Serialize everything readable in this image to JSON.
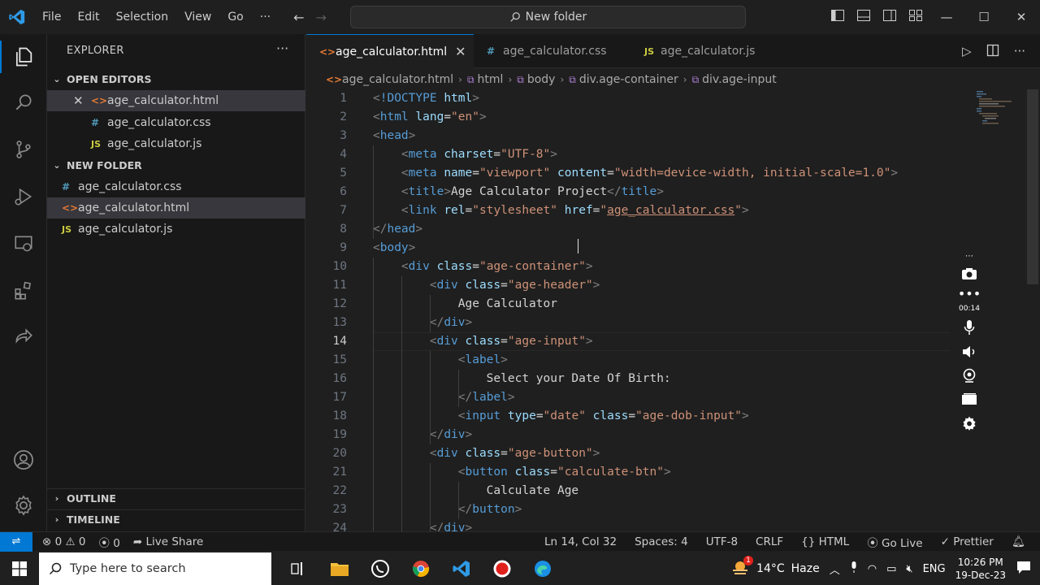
{
  "menu": [
    "File",
    "Edit",
    "Selection",
    "View",
    "Go",
    "···"
  ],
  "search": {
    "label": "New folder"
  },
  "explorer": {
    "title": "EXPLORER",
    "more": "···",
    "open_editors": {
      "label": "OPEN EDITORS",
      "items": [
        {
          "name": "age_calculator.html",
          "type": "html"
        },
        {
          "name": "age_calculator.css",
          "type": "css"
        },
        {
          "name": "age_calculator.js",
          "type": "js"
        }
      ]
    },
    "folder": {
      "label": "NEW FOLDER",
      "items": [
        {
          "name": "age_calculator.css",
          "type": "css"
        },
        {
          "name": "age_calculator.html",
          "type": "html"
        },
        {
          "name": "age_calculator.js",
          "type": "js"
        }
      ]
    },
    "outline": "OUTLINE",
    "timeline": "TIMELINE"
  },
  "tabs": [
    {
      "label": "age_calculator.html",
      "type": "html",
      "active": true
    },
    {
      "label": "age_calculator.css",
      "type": "css",
      "active": false
    },
    {
      "label": "age_calculator.js",
      "type": "js",
      "active": false
    }
  ],
  "breadcrumb": [
    "age_calculator.html",
    "html",
    "body",
    "div.age-container",
    "div.age-input"
  ],
  "code": {
    "current_line": 14,
    "lines": [
      [
        [
          "pun",
          "<"
        ],
        [
          "tag",
          "!DOCTYPE "
        ],
        [
          "attr",
          "html"
        ],
        [
          "pun",
          ">"
        ]
      ],
      [
        [
          "pun",
          "<"
        ],
        [
          "tag",
          "html "
        ],
        [
          "attr",
          "lang"
        ],
        [
          "plain",
          "="
        ],
        [
          "str",
          "\"en\""
        ],
        [
          "pun",
          ">"
        ]
      ],
      [
        [
          "pun",
          "<"
        ],
        [
          "tag",
          "head"
        ],
        [
          "pun",
          ">"
        ]
      ],
      [
        [
          "plain",
          "    "
        ],
        [
          "pun",
          "<"
        ],
        [
          "tag",
          "meta "
        ],
        [
          "attr",
          "charset"
        ],
        [
          "plain",
          "="
        ],
        [
          "str",
          "\"UTF-8\""
        ],
        [
          "pun",
          ">"
        ]
      ],
      [
        [
          "plain",
          "    "
        ],
        [
          "pun",
          "<"
        ],
        [
          "tag",
          "meta "
        ],
        [
          "attr",
          "name"
        ],
        [
          "plain",
          "="
        ],
        [
          "str",
          "\"viewport\" "
        ],
        [
          "attr",
          "content"
        ],
        [
          "plain",
          "="
        ],
        [
          "str",
          "\"width=device-width, initial-scale=1.0\""
        ],
        [
          "pun",
          ">"
        ]
      ],
      [
        [
          "plain",
          "    "
        ],
        [
          "pun",
          "<"
        ],
        [
          "tag",
          "title"
        ],
        [
          "pun",
          ">"
        ],
        [
          "plain",
          "Age Calculator Project"
        ],
        [
          "pun",
          "</"
        ],
        [
          "tag",
          "title"
        ],
        [
          "pun",
          ">"
        ]
      ],
      [
        [
          "plain",
          "    "
        ],
        [
          "pun",
          "<"
        ],
        [
          "tag",
          "link "
        ],
        [
          "attr",
          "rel"
        ],
        [
          "plain",
          "="
        ],
        [
          "str",
          "\"stylesheet\" "
        ],
        [
          "attr",
          "href"
        ],
        [
          "plain",
          "="
        ],
        [
          "str",
          "\""
        ],
        [
          "strlink",
          "age_calculator.css"
        ],
        [
          "str",
          "\""
        ],
        [
          "pun",
          ">"
        ]
      ],
      [
        [
          "pun",
          "</"
        ],
        [
          "tag",
          "head"
        ],
        [
          "pun",
          ">"
        ]
      ],
      [
        [
          "pun",
          "<"
        ],
        [
          "tag",
          "body"
        ],
        [
          "pun",
          ">"
        ]
      ],
      [
        [
          "plain",
          "    "
        ],
        [
          "pun",
          "<"
        ],
        [
          "tag",
          "div "
        ],
        [
          "attr",
          "class"
        ],
        [
          "plain",
          "="
        ],
        [
          "str",
          "\"age-container\""
        ],
        [
          "pun",
          ">"
        ]
      ],
      [
        [
          "plain",
          "        "
        ],
        [
          "pun",
          "<"
        ],
        [
          "tag",
          "div "
        ],
        [
          "attr",
          "class"
        ],
        [
          "plain",
          "="
        ],
        [
          "str",
          "\"age-header\""
        ],
        [
          "pun",
          ">"
        ]
      ],
      [
        [
          "plain",
          "            Age Calculator"
        ]
      ],
      [
        [
          "plain",
          "        "
        ],
        [
          "pun",
          "</"
        ],
        [
          "tag",
          "div"
        ],
        [
          "pun",
          ">"
        ]
      ],
      [
        [
          "plain",
          "        "
        ],
        [
          "pun",
          "<"
        ],
        [
          "tag",
          "div "
        ],
        [
          "attr",
          "class"
        ],
        [
          "plain",
          "="
        ],
        [
          "str",
          "\"age-input\""
        ],
        [
          "pun",
          ">"
        ]
      ],
      [
        [
          "plain",
          "            "
        ],
        [
          "pun",
          "<"
        ],
        [
          "tag",
          "label"
        ],
        [
          "pun",
          ">"
        ]
      ],
      [
        [
          "plain",
          "                Select your Date Of Birth:"
        ]
      ],
      [
        [
          "plain",
          "            "
        ],
        [
          "pun",
          "</"
        ],
        [
          "tag",
          "label"
        ],
        [
          "pun",
          ">"
        ]
      ],
      [
        [
          "plain",
          "            "
        ],
        [
          "pun",
          "<"
        ],
        [
          "tag",
          "input "
        ],
        [
          "attr",
          "type"
        ],
        [
          "plain",
          "="
        ],
        [
          "str",
          "\"date\" "
        ],
        [
          "attr",
          "class"
        ],
        [
          "plain",
          "="
        ],
        [
          "str",
          "\"age-dob-input\""
        ],
        [
          "pun",
          ">"
        ]
      ],
      [
        [
          "plain",
          "        "
        ],
        [
          "pun",
          "</"
        ],
        [
          "tag",
          "div"
        ],
        [
          "pun",
          ">"
        ]
      ],
      [
        [
          "plain",
          "        "
        ],
        [
          "pun",
          "<"
        ],
        [
          "tag",
          "div "
        ],
        [
          "attr",
          "class"
        ],
        [
          "plain",
          "="
        ],
        [
          "str",
          "\"age-button\""
        ],
        [
          "pun",
          ">"
        ]
      ],
      [
        [
          "plain",
          "            "
        ],
        [
          "pun",
          "<"
        ],
        [
          "tag",
          "button "
        ],
        [
          "attr",
          "class"
        ],
        [
          "plain",
          "="
        ],
        [
          "str",
          "\"calculate-btn\""
        ],
        [
          "pun",
          ">"
        ]
      ],
      [
        [
          "plain",
          "                Calculate Age"
        ]
      ],
      [
        [
          "plain",
          "            "
        ],
        [
          "pun",
          "</"
        ],
        [
          "tag",
          "button"
        ],
        [
          "pun",
          ">"
        ]
      ],
      [
        [
          "plain",
          "        "
        ],
        [
          "pun",
          "</"
        ],
        [
          "tag",
          "div"
        ],
        [
          "pun",
          ">"
        ]
      ]
    ]
  },
  "recorder": {
    "time": "00:14"
  },
  "status": {
    "errors": "0",
    "warnings": "0",
    "ports": "0",
    "live_share": "Live Share",
    "position": "Ln 14, Col 32",
    "spaces": "Spaces: 4",
    "encoding": "UTF-8",
    "eol": "CRLF",
    "language": "HTML",
    "go_live": "Go Live",
    "prettier": "Prettier"
  },
  "taskbar": {
    "search_placeholder": "Type here to search",
    "weather_temp": "14°C",
    "weather_desc": "Haze",
    "weather_badge": "1",
    "lang": "ENG",
    "time": "10:26 PM",
    "date": "19-Dec-23"
  },
  "colors": {
    "accent": "#0078d4",
    "html": "#e37933",
    "css": "#519aba",
    "js": "#cbcb41"
  }
}
